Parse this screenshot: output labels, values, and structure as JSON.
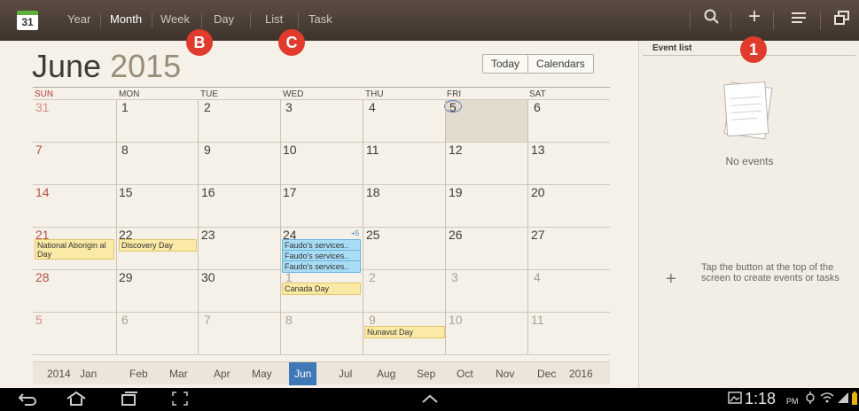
{
  "toolbar": {
    "app_icon_day": "31",
    "views": [
      "Year",
      "Month",
      "Week",
      "Day",
      "List",
      "Task"
    ],
    "active_view": "Month"
  },
  "calendar": {
    "month": "June",
    "year": "2015",
    "today_button": "Today",
    "calendars_button": "Calendars",
    "weekdays": [
      "SUN",
      "MON",
      "TUE",
      "WED",
      "THU",
      "FRI",
      "SAT"
    ],
    "weeks": [
      [
        "31",
        "1",
        "2",
        "3",
        "4",
        "5",
        "6"
      ],
      [
        "7",
        "8",
        "9",
        "10",
        "11",
        "12",
        "13"
      ],
      [
        "14",
        "15",
        "16",
        "17",
        "18",
        "19",
        "20"
      ],
      [
        "21",
        "22",
        "23",
        "24",
        "25",
        "26",
        "27"
      ],
      [
        "28",
        "29",
        "30",
        "1",
        "2",
        "3",
        "4"
      ],
      [
        "5",
        "6",
        "7",
        "8",
        "9",
        "10",
        "11"
      ]
    ],
    "events": {
      "national_aboriginal": "National Aborigin al Day",
      "discovery_day": "Discovery Day",
      "faudo_1": "Faudo's services..",
      "faudo_2": "Faudo's services..",
      "faudo_3": "Faudo's services..",
      "more_count": "+5",
      "canada_day": "Canada Day",
      "nunavut_day": "Nunavut Day"
    },
    "month_strip": [
      "2014",
      "Jan",
      "Feb",
      "Mar",
      "Apr",
      "May",
      "Jun",
      "Jul",
      "Aug",
      "Sep",
      "Oct",
      "Nov",
      "Dec",
      "2016"
    ],
    "selected_month": "Jun"
  },
  "event_list": {
    "title": "Event list",
    "empty_text": "No events",
    "hint": "Tap the button at the top of the screen to create events or tasks"
  },
  "annotations": {
    "badge_1": "1",
    "badge_b": "B",
    "badge_c": "C"
  },
  "status_bar": {
    "time": "1:18",
    "ampm": "PM"
  },
  "colors": {
    "topbar": "#4a3e35",
    "accent_blue": "#3e78b6",
    "badge_red": "#e13b2d",
    "event_yellow": "#fbe9a6",
    "event_blue": "#a9dcf5"
  }
}
